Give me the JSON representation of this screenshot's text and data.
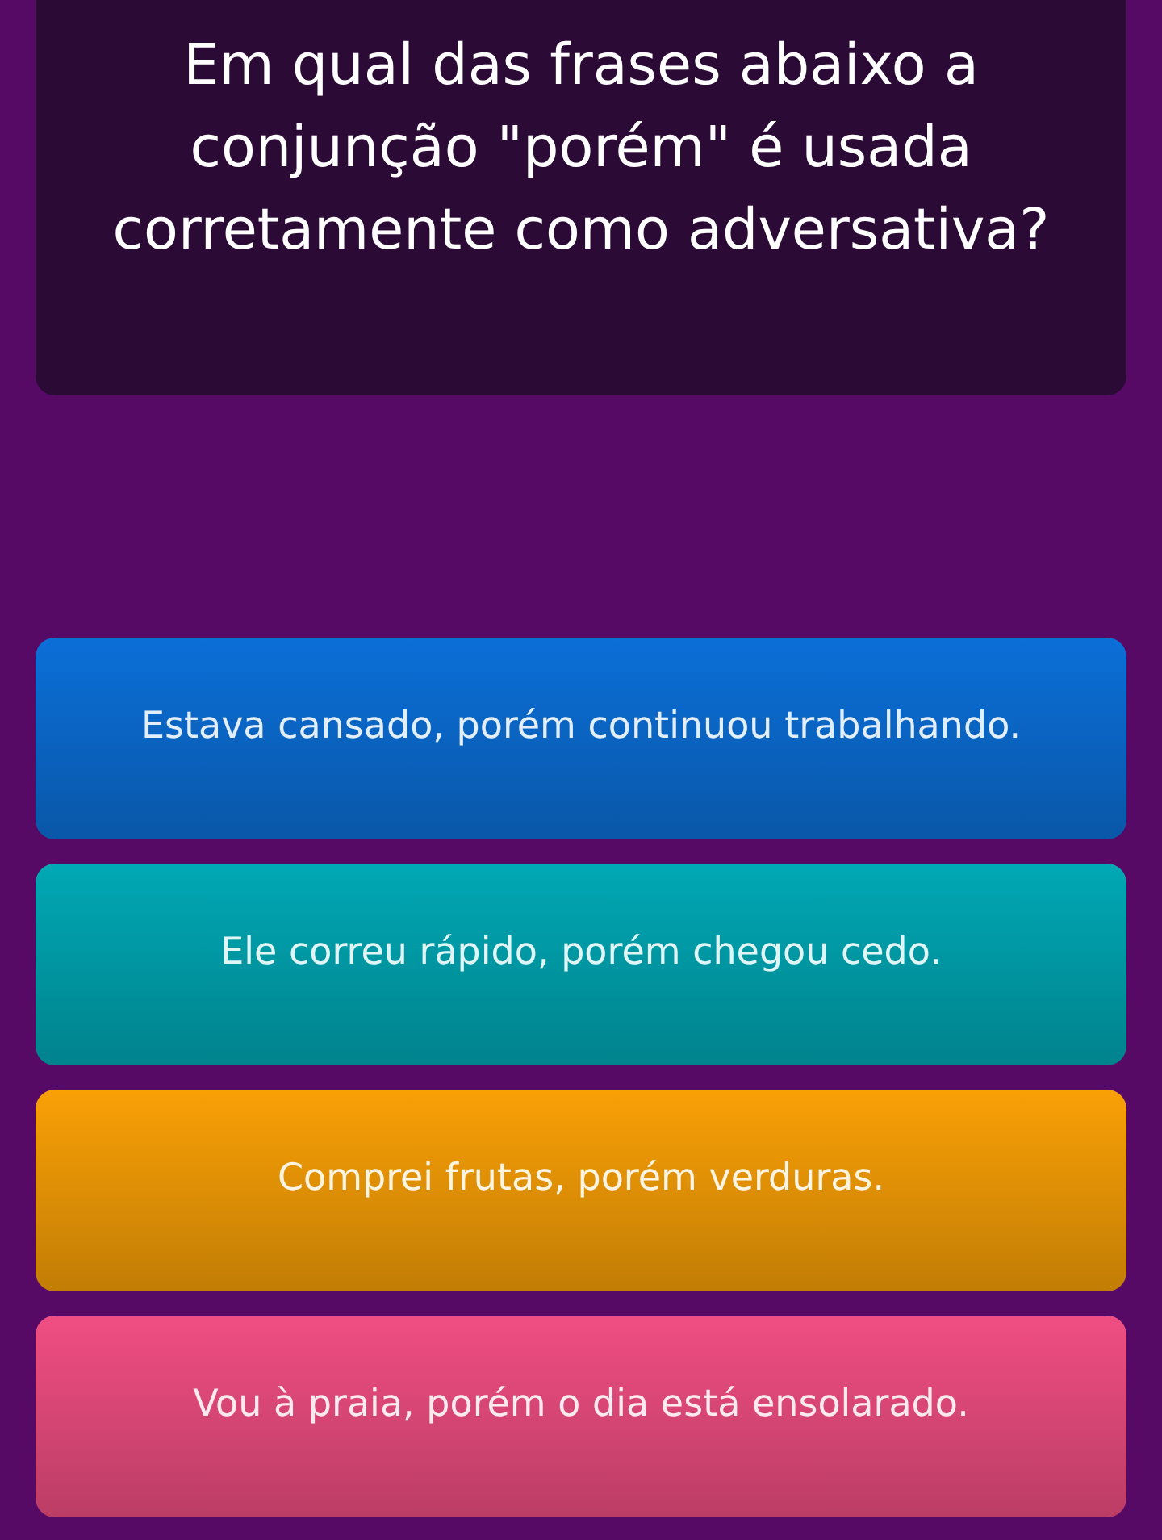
{
  "question": {
    "text": "Em qual das frases abaixo a conjunção \"porém\" é usada corretamente como adversativa?"
  },
  "answers": [
    {
      "text": "Estava cansado, porém continuou trabalhando.",
      "color": "#0b6fd8"
    },
    {
      "text": "Ele correu rápido, porém chegou cedo.",
      "color": "#00a8b5"
    },
    {
      "text": "Comprei frutas, porém verduras.",
      "color": "#f9a006"
    },
    {
      "text": "Vou à praia, porém o dia está ensolarado.",
      "color": "#f04e82"
    }
  ]
}
